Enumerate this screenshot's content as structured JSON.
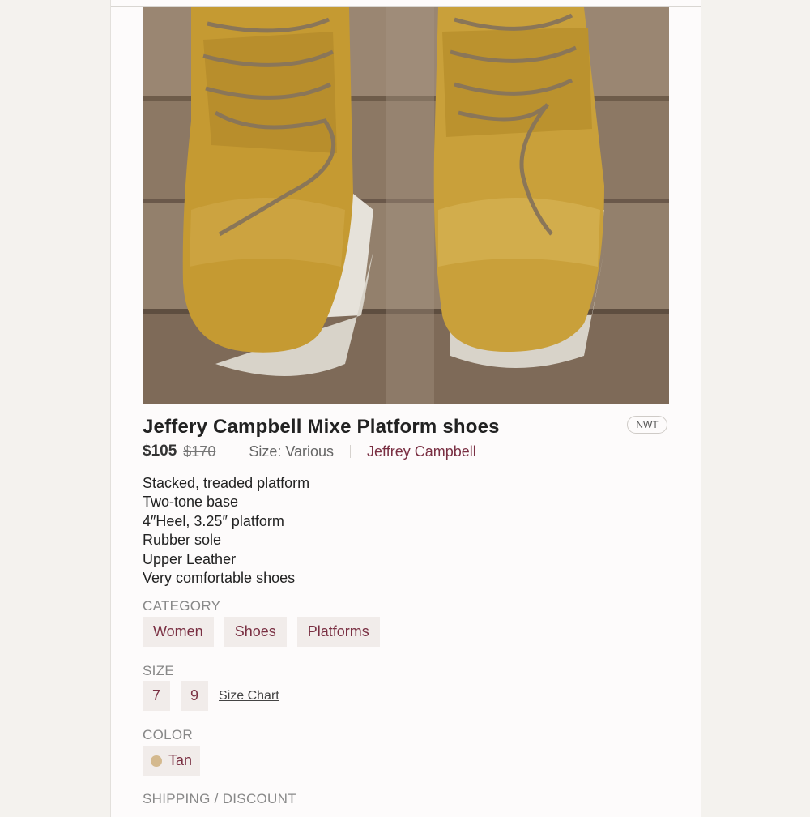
{
  "listing": {
    "title": "Jeffery Campbell Mixe Platform shoes",
    "condition_badge": "NWT",
    "price": "$105",
    "original_price": "$170",
    "size_summary": "Size: Various",
    "brand": "Jeffrey Campbell",
    "description_lines": [
      "Stacked, treaded platform",
      "Two-tone base",
      "4″Heel, 3.25″ platform",
      "Rubber sole",
      "Upper Leather",
      "Very comfortable shoes"
    ]
  },
  "category": {
    "label": "CATEGORY",
    "items": [
      "Women",
      "Shoes",
      "Platforms"
    ]
  },
  "size": {
    "label": "SIZE",
    "options": [
      "7",
      "9"
    ],
    "size_chart_link": "Size Chart"
  },
  "color": {
    "label": "COLOR",
    "value": "Tan",
    "swatch": "#d4b98e"
  },
  "shipping": {
    "label": "SHIPPING / DISCOUNT"
  },
  "colors": {
    "accent": "#7a3043",
    "chip_bg": "#f1ecea",
    "shoe": "#c9a03a",
    "sole": "#e8e4dc"
  }
}
